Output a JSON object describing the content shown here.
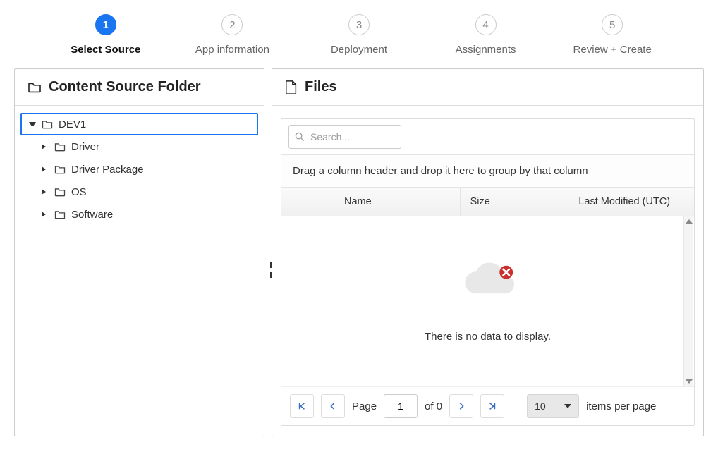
{
  "stepper": {
    "steps": [
      {
        "num": "1",
        "label": "Select Source",
        "active": true
      },
      {
        "num": "2",
        "label": "App information",
        "active": false
      },
      {
        "num": "3",
        "label": "Deployment",
        "active": false
      },
      {
        "num": "4",
        "label": "Assignments",
        "active": false
      },
      {
        "num": "5",
        "label": "Review + Create",
        "active": false
      }
    ]
  },
  "leftPanel": {
    "title": "Content Source Folder",
    "tree": [
      {
        "label": "DEV1",
        "level": 0,
        "expanded": true,
        "selected": true
      },
      {
        "label": "Driver",
        "level": 1,
        "expanded": false,
        "selected": false
      },
      {
        "label": "Driver Package",
        "level": 1,
        "expanded": false,
        "selected": false
      },
      {
        "label": "OS",
        "level": 1,
        "expanded": false,
        "selected": false
      },
      {
        "label": "Software",
        "level": 1,
        "expanded": false,
        "selected": false
      }
    ]
  },
  "rightPanel": {
    "title": "Files",
    "searchPlaceholder": "Search...",
    "groupHint": "Drag a column header and drop it here to group by that column",
    "columns": {
      "name": "Name",
      "size": "Size",
      "modified": "Last Modified (UTC)"
    },
    "rows": [],
    "emptyText": "There is no data to display.",
    "pager": {
      "pageLabel": "Page",
      "page": "1",
      "ofLabel": "of 0",
      "pageSize": "10",
      "perPageLabel": "items per page"
    }
  }
}
